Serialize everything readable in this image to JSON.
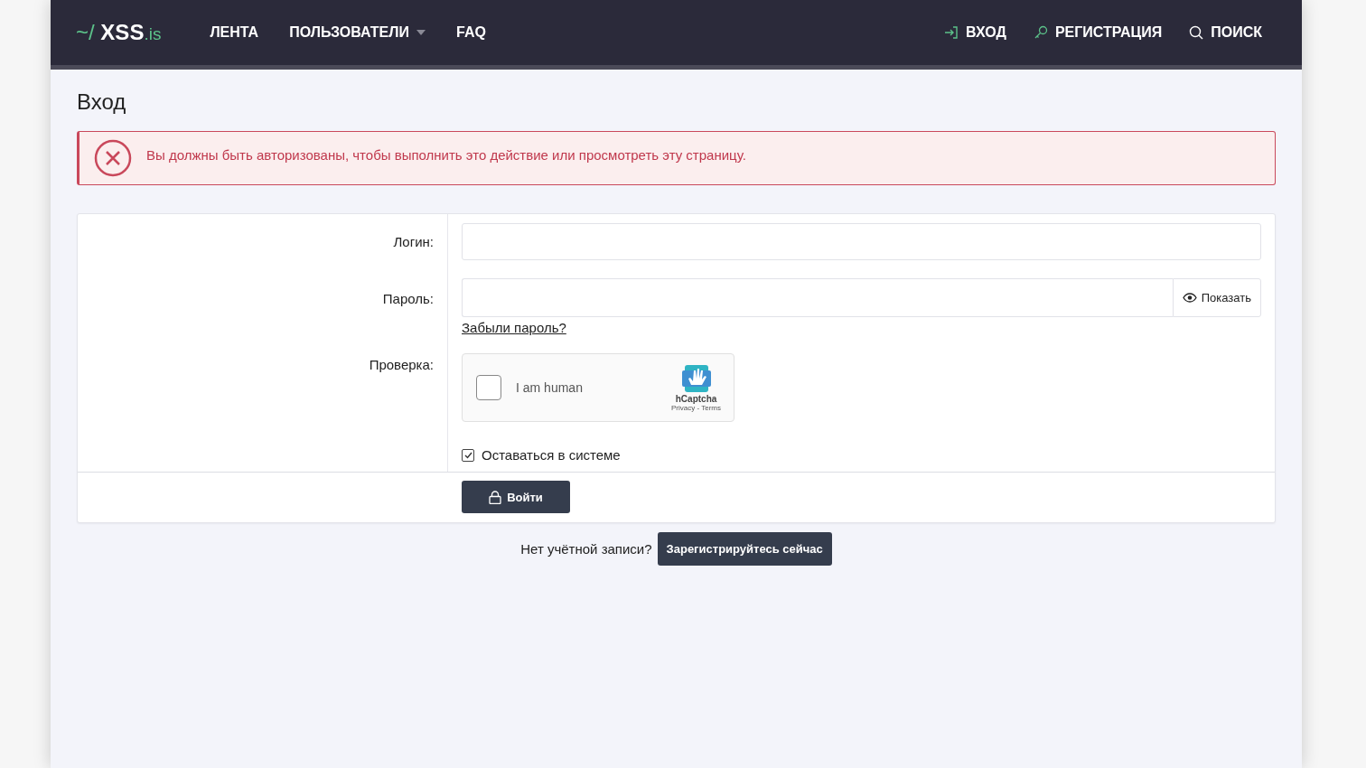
{
  "header": {
    "logo": {
      "prefix": "~/",
      "name": "XSS",
      "suffix": ".is"
    },
    "nav": [
      {
        "label": "ЛЕНТА",
        "dropdown": false
      },
      {
        "label": "ПОЛЬЗОВАТЕЛИ",
        "dropdown": true
      },
      {
        "label": "FAQ",
        "dropdown": false
      }
    ],
    "actions": [
      {
        "kind": "login",
        "label": "ВХОД"
      },
      {
        "kind": "register",
        "label": "РЕГИСТРАЦИЯ"
      },
      {
        "kind": "search",
        "label": "ПОИСК"
      }
    ]
  },
  "page_title": "Вход",
  "error": "Вы должны быть авторизованы, чтобы выполнить это действие или просмотреть эту страницу.",
  "form": {
    "login_label": "Логин:",
    "password_label": "Пароль:",
    "show_password": "Показать",
    "forgot": "Забыли пароль?",
    "captcha_label": "Проверка:",
    "captcha": {
      "checked": false,
      "text": "I am human",
      "brand": "hCaptcha",
      "links": "Privacy - Terms"
    },
    "remember": {
      "label": "Оставаться в системе",
      "checked": true
    },
    "submit": "Войти"
  },
  "signup": {
    "text": "Нет учётной записи?",
    "button": "Зарегистрируйтесь сейчас"
  }
}
